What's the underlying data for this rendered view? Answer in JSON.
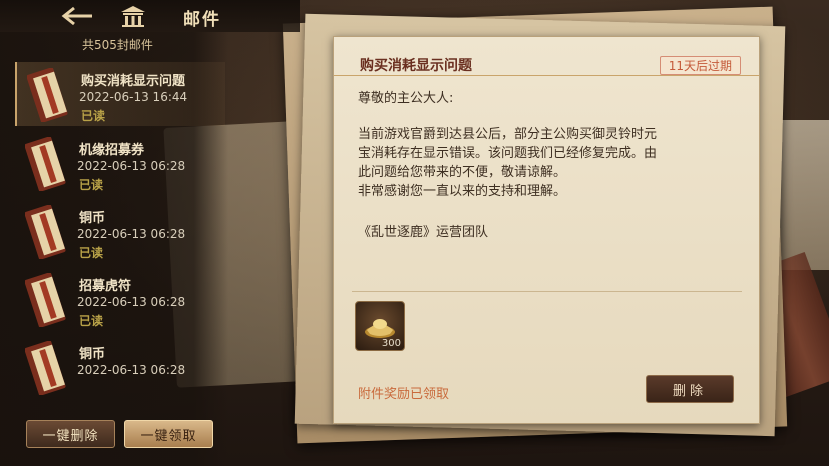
{
  "header": {
    "title": "邮件",
    "back_icon": "back-arrow-icon",
    "home_icon": "pavilion-home-icon"
  },
  "mail_count_label": "共505封邮件",
  "mails": [
    {
      "title": "购买消耗显示问题",
      "date": "2022-06-13 16:44",
      "status": "已读",
      "selected": true
    },
    {
      "title": "机缘招募券",
      "date": "2022-06-13 06:28",
      "status": "已读"
    },
    {
      "title": "铜币",
      "date": "2022-06-13 06:28",
      "status": "已读"
    },
    {
      "title": "招募虎符",
      "date": "2022-06-13 06:28",
      "status": "已读"
    },
    {
      "title": "铜币",
      "date": "2022-06-13 06:28",
      "status": ""
    }
  ],
  "buttons": {
    "delete_all": "一键删除",
    "claim_all": "一键领取",
    "delete": "删除"
  },
  "detail": {
    "title": "购买消耗显示问题",
    "expire": "11天后过期",
    "greeting": "尊敬的主公大人:",
    "paragraph_lines": [
      "当前游戏官爵到达县公后，部分主公购买御灵铃时元",
      "宝消耗存在显示错误。该问题我们已经修复完成。由",
      "此问题给您带来的不便，敬请谅解。",
      "非常感谢您一直以来的支持和理解。"
    ],
    "signature": "《乱世逐鹿》运营团队",
    "attachment": {
      "icon": "gold-ingot-icon",
      "quantity": "300"
    },
    "claimed_text": "附件奖励已领取"
  },
  "colors": {
    "accent_gold": "#c9a46b",
    "title_red": "#6a2f20",
    "expire_red": "#c45a3a"
  }
}
